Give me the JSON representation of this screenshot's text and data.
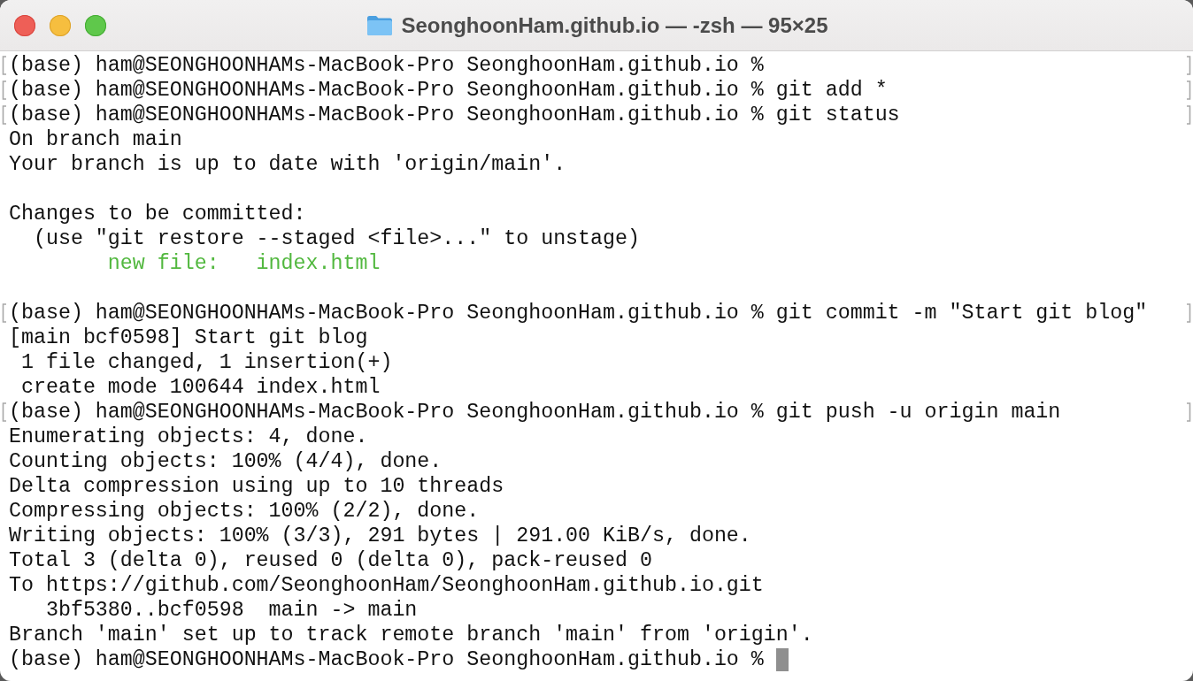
{
  "window": {
    "title": "SeonghoonHam.github.io — -zsh — 95×25"
  },
  "terminal": {
    "lines": [
      {
        "kind": "text",
        "text": "(base) ham@SEONGHOONHAMs-MacBook-Pro SeonghoonHam.github.io %",
        "marked": true,
        "cursor": false
      },
      {
        "kind": "text",
        "text": "(base) ham@SEONGHOONHAMs-MacBook-Pro SeonghoonHam.github.io % git add *",
        "marked": true,
        "cursor": false
      },
      {
        "kind": "text",
        "text": "(base) ham@SEONGHOONHAMs-MacBook-Pro SeonghoonHam.github.io % git status",
        "marked": true,
        "cursor": false
      },
      {
        "kind": "text",
        "text": "On branch main",
        "marked": false,
        "cursor": false
      },
      {
        "kind": "text",
        "text": "Your branch is up to date with 'origin/main'.",
        "marked": false,
        "cursor": false
      },
      {
        "kind": "blank",
        "marked": false,
        "cursor": false
      },
      {
        "kind": "text",
        "text": "Changes to be committed:",
        "marked": false,
        "cursor": false
      },
      {
        "kind": "text",
        "text": "  (use \"git restore --staged <file>...\" to unstage)",
        "marked": false,
        "cursor": false
      },
      {
        "kind": "staged",
        "text": "        new file:   index.html",
        "marked": false,
        "cursor": false
      },
      {
        "kind": "blank",
        "marked": false,
        "cursor": false
      },
      {
        "kind": "text",
        "text": "(base) ham@SEONGHOONHAMs-MacBook-Pro SeonghoonHam.github.io % git commit -m \"Start git blog\"",
        "marked": true,
        "cursor": false
      },
      {
        "kind": "text",
        "text": "[main bcf0598] Start git blog",
        "marked": false,
        "cursor": false
      },
      {
        "kind": "text",
        "text": " 1 file changed, 1 insertion(+)",
        "marked": false,
        "cursor": false
      },
      {
        "kind": "text",
        "text": " create mode 100644 index.html",
        "marked": false,
        "cursor": false
      },
      {
        "kind": "text",
        "text": "(base) ham@SEONGHOONHAMs-MacBook-Pro SeonghoonHam.github.io % git push -u origin main",
        "marked": true,
        "cursor": false
      },
      {
        "kind": "text",
        "text": "Enumerating objects: 4, done.",
        "marked": false,
        "cursor": false
      },
      {
        "kind": "text",
        "text": "Counting objects: 100% (4/4), done.",
        "marked": false,
        "cursor": false
      },
      {
        "kind": "text",
        "text": "Delta compression using up to 10 threads",
        "marked": false,
        "cursor": false
      },
      {
        "kind": "text",
        "text": "Compressing objects: 100% (2/2), done.",
        "marked": false,
        "cursor": false
      },
      {
        "kind": "text",
        "text": "Writing objects: 100% (3/3), 291 bytes | 291.00 KiB/s, done.",
        "marked": false,
        "cursor": false
      },
      {
        "kind": "text",
        "text": "Total 3 (delta 0), reused 0 (delta 0), pack-reused 0",
        "marked": false,
        "cursor": false
      },
      {
        "kind": "text",
        "text": "To https://github.com/SeonghoonHam/SeonghoonHam.github.io.git",
        "marked": false,
        "cursor": false
      },
      {
        "kind": "text",
        "text": "   3bf5380..bcf0598  main -> main",
        "marked": false,
        "cursor": false
      },
      {
        "kind": "text",
        "text": "Branch 'main' set up to track remote branch 'main' from 'origin'.",
        "marked": false,
        "cursor": false
      },
      {
        "kind": "text",
        "text": "(base) ham@SEONGHOONHAMs-MacBook-Pro SeonghoonHam.github.io %",
        "marked": false,
        "cursor": true
      }
    ]
  }
}
